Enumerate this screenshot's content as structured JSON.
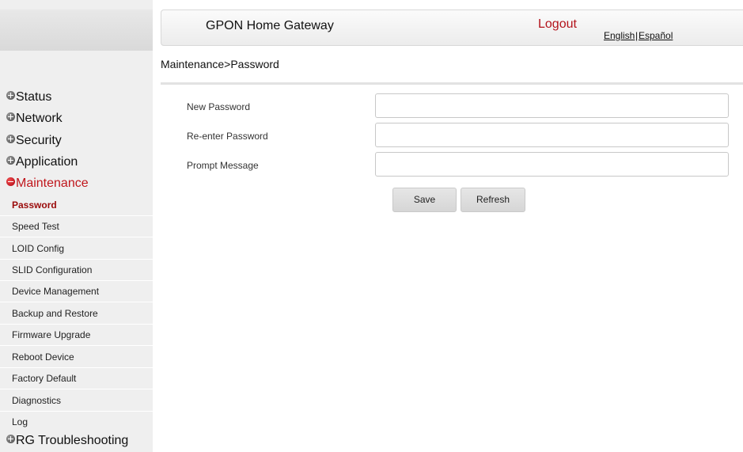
{
  "header": {
    "title": "GPON Home Gateway",
    "logout_label": "Logout",
    "lang_english": "English",
    "lang_separator": "|",
    "lang_spanish": "Español"
  },
  "breadcrumb": "Maintenance>Password",
  "sidebar": {
    "menu": [
      {
        "label": "Status",
        "icon": "plus-icon",
        "expanded": false
      },
      {
        "label": "Network",
        "icon": "plus-icon",
        "expanded": false
      },
      {
        "label": "Security",
        "icon": "plus-icon",
        "expanded": false
      },
      {
        "label": "Application",
        "icon": "plus-icon",
        "expanded": false
      },
      {
        "label": "Maintenance",
        "icon": "minus-icon",
        "expanded": true
      },
      {
        "label": "RG Troubleshooting",
        "icon": "plus-icon",
        "expanded": false
      }
    ],
    "maintenance_items": [
      {
        "label": "Password",
        "active": true
      },
      {
        "label": "Speed Test",
        "active": false
      },
      {
        "label": "LOID Config",
        "active": false
      },
      {
        "label": "SLID Configuration",
        "active": false
      },
      {
        "label": "Device Management",
        "active": false
      },
      {
        "label": "Backup and Restore",
        "active": false
      },
      {
        "label": "Firmware Upgrade",
        "active": false
      },
      {
        "label": "Reboot Device",
        "active": false
      },
      {
        "label": "Factory Default",
        "active": false
      },
      {
        "label": "Diagnostics",
        "active": false
      },
      {
        "label": "Log",
        "active": false
      }
    ]
  },
  "form": {
    "new_password": {
      "label": "New Password",
      "value": ""
    },
    "reenter_password": {
      "label": "Re-enter Password",
      "value": ""
    },
    "prompt_message": {
      "label": "Prompt Message",
      "value": ""
    },
    "save_label": "Save",
    "refresh_label": "Refresh"
  },
  "colors": {
    "accent": "#c0161c",
    "active_sub": "#9a0a0a",
    "sidebar_bg": "#efefef"
  }
}
